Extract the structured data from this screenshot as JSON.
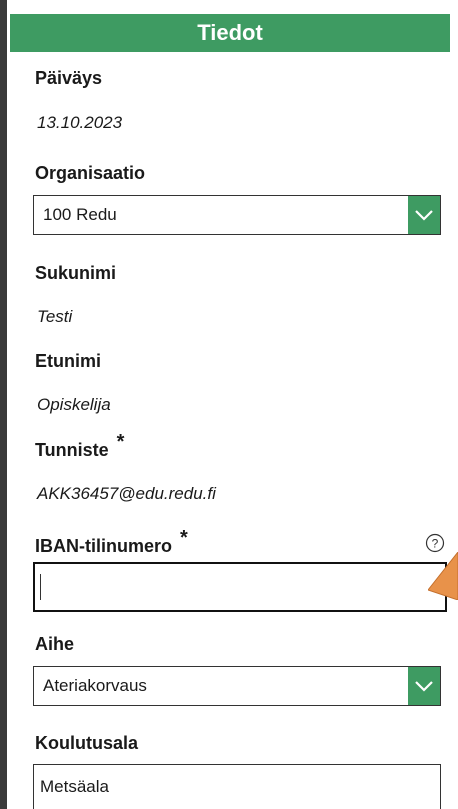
{
  "header": {
    "title": "Tiedot"
  },
  "form": {
    "paivays": {
      "label": "Päiväys",
      "value": "13.10.2023"
    },
    "organisaatio": {
      "label": "Organisaatio",
      "selected": "100 Redu"
    },
    "sukunimi": {
      "label": "Sukunimi",
      "value": "Testi"
    },
    "etunimi": {
      "label": "Etunimi",
      "value": "Opiskelija"
    },
    "tunniste": {
      "label": "Tunniste",
      "required_mark": "*",
      "value": "AKK36457@edu.redu.fi"
    },
    "iban": {
      "label": "IBAN-tilinumero",
      "required_mark": "*",
      "value": ""
    },
    "aihe": {
      "label": "Aihe",
      "selected": "Ateriakorvaus"
    },
    "koulutusala": {
      "label": "Koulutusala",
      "value": "Metsäala"
    }
  },
  "icons": {
    "dropdown": "chevron-down-icon",
    "help": "question-circle-icon"
  },
  "colors": {
    "accent": "#3e9b62",
    "header_text": "#ffffff",
    "pointer_arrow": "#e8924a"
  }
}
